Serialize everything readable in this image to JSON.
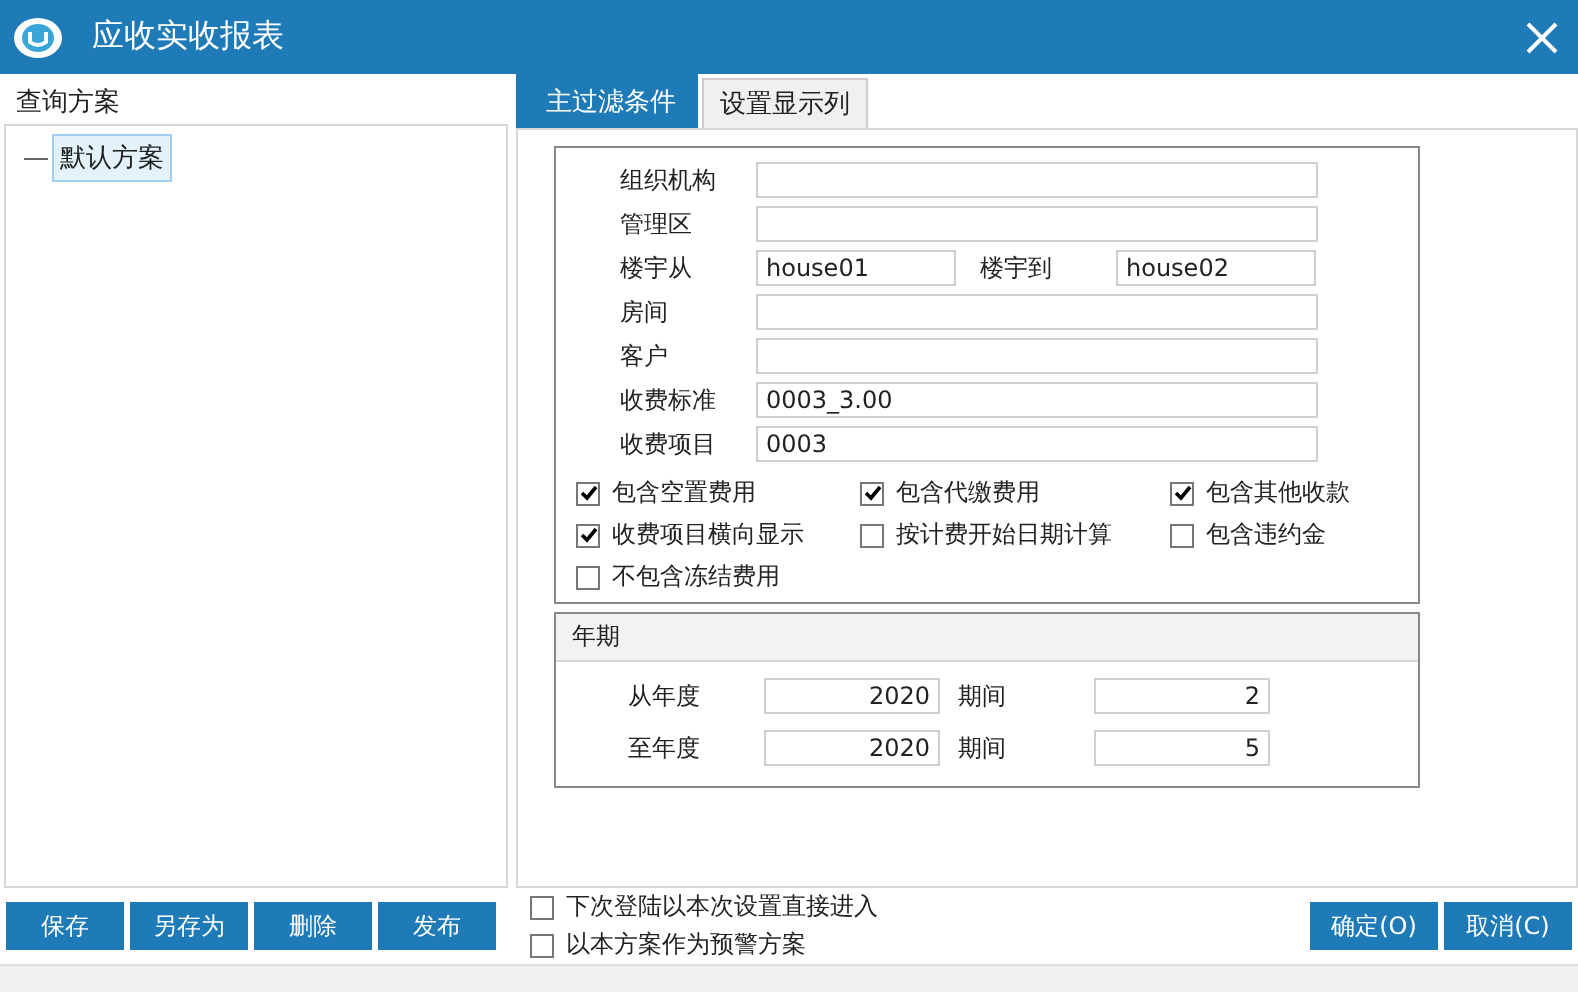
{
  "window": {
    "title": "应收实收报表"
  },
  "left_panel": {
    "title": "查询方案",
    "tree": [
      {
        "label": "默认方案",
        "selected": true
      }
    ]
  },
  "tabs": [
    {
      "label": "主过滤条件",
      "selected": true
    },
    {
      "label": "设置显示列",
      "selected": false
    }
  ],
  "filter": {
    "fields": [
      {
        "kind": "single",
        "label": "组织机构"
      },
      {
        "kind": "single",
        "label": "管理区"
      },
      {
        "kind": "range",
        "label": "楼宇从",
        "value": "house01",
        "label_2": "楼宇到",
        "value_2": "house02"
      },
      {
        "kind": "single",
        "label": "房间"
      },
      {
        "kind": "single",
        "label": "客户"
      },
      {
        "kind": "single",
        "label": "收费标准",
        "value": "0003_3.00"
      },
      {
        "kind": "single",
        "label": "收费项目",
        "value": "0003"
      }
    ],
    "options": [
      {
        "label": "包含空置费用",
        "checked": true
      },
      {
        "label": "包含代缴费用",
        "checked": true
      },
      {
        "label": "包含其他收款",
        "checked": true
      },
      {
        "label": "收费项目横向显示",
        "checked": true
      },
      {
        "label": "按计费开始日期计算",
        "checked": false
      },
      {
        "label": "包含违约金",
        "checked": false
      },
      {
        "label": "不包含冻结费用",
        "checked": false
      }
    ]
  },
  "period": {
    "title": "年期",
    "rows": [
      {
        "year_label": "从年度",
        "year": "2020",
        "period_label": "期间",
        "period": "2"
      },
      {
        "year_label": "至年度",
        "year": "2020",
        "period_label": "期间",
        "period": "5"
      }
    ]
  },
  "left_buttons": [
    "保存",
    "另存为",
    "删除",
    "发布"
  ],
  "bottom_options": [
    {
      "label": "下次登陆以本次设置直接进入",
      "checked": false
    },
    {
      "label": "以本方案作为预警方案",
      "checked": false
    }
  ],
  "right_buttons": [
    "确定(O)",
    "取消(C)"
  ]
}
